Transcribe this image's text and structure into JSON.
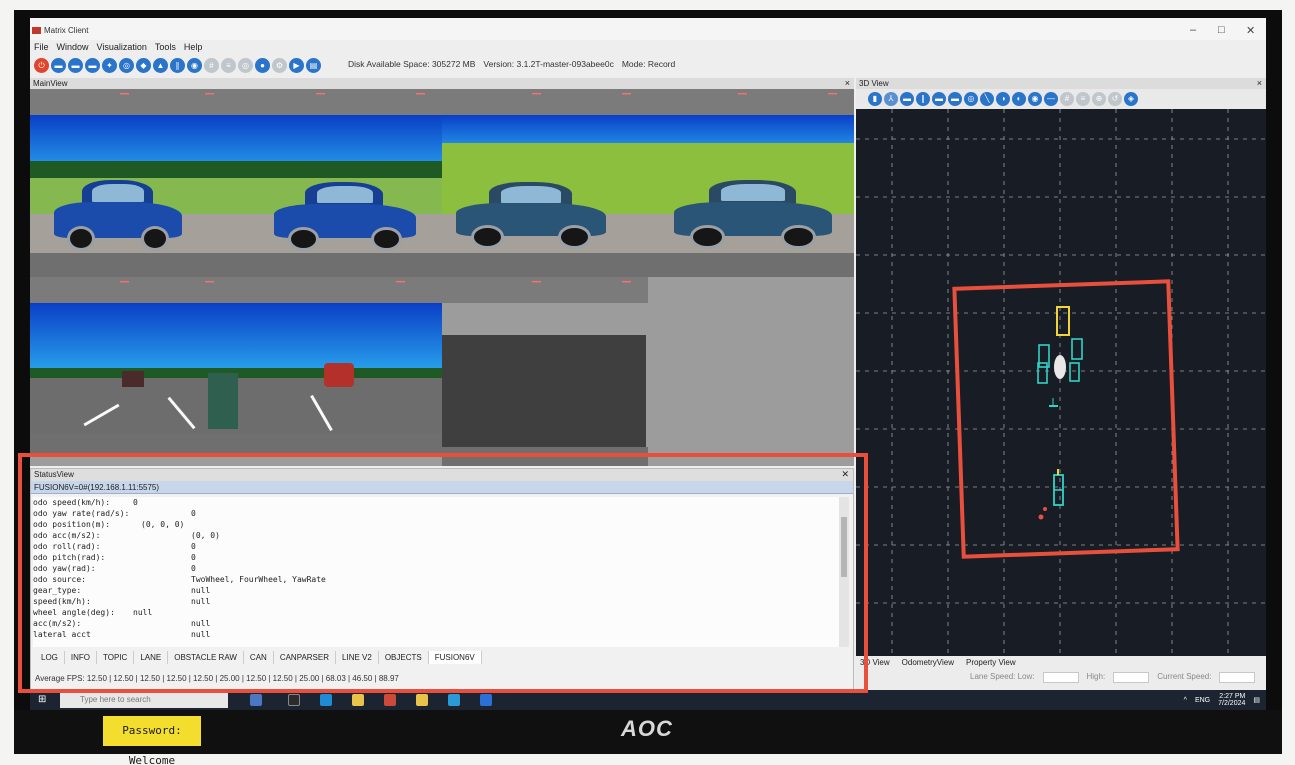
{
  "window": {
    "title": "Matrix Client",
    "controls": [
      "–",
      "□",
      "✕"
    ]
  },
  "menu": [
    "File",
    "Window",
    "Visualization",
    "Tools",
    "Help"
  ],
  "toolbar": {
    "disk": "Disk Available Space: 305272 MB",
    "version": "Version: 3.1.2T-master-093abee0c",
    "mode": "Mode: Record"
  },
  "mainview": {
    "title": "MainView",
    "close": "×"
  },
  "statusview": {
    "title": "StatusView",
    "source": "FUSION6V=0#(192.168.1.11:5575)",
    "lines": [
      {
        "k": "odo speed(km/h):",
        "v": "0",
        "vx": 100
      },
      {
        "k": "odo yaw rate(rad/s):",
        "v": "0",
        "vx": 158
      },
      {
        "k": "odo position(m):",
        "v": "(0, 0, 0)",
        "vx": 108
      },
      {
        "k": "odo acc(m/s2):",
        "v": "(0, 0)",
        "vx": 158
      },
      {
        "k": "odo roll(rad):",
        "v": "0",
        "vx": 158
      },
      {
        "k": "odo pitch(rad):",
        "v": "0",
        "vx": 158
      },
      {
        "k": "odo yaw(rad):",
        "v": "0",
        "vx": 158
      },
      {
        "k": "odo source:",
        "v": "TwoWheel, FourWheel, YawRate",
        "vx": 158
      },
      {
        "k": "gear_type:",
        "v": "null",
        "vx": 158
      },
      {
        "k": "speed(km/h):",
        "v": "null",
        "vx": 158
      },
      {
        "k": "wheel angle(deg):",
        "v": "null",
        "vx": 100
      },
      {
        "k": "acc(m/s2):",
        "v": "null",
        "vx": 158
      },
      {
        "k": "lateral acct",
        "v": "null",
        "vx": 158
      }
    ],
    "tabs": [
      "LOG",
      "INFO",
      "TOPIC",
      "LANE",
      "OBSTACLE RAW",
      "CAN",
      "CANPARSER",
      "LINE V2",
      "OBJECTS",
      "FUSION6V"
    ],
    "active_tab": "FUSION6V",
    "fps": "Average FPS:  12.50 | 12.50 | 12.50 | 12.50 | 12.50 | 25.00 | 12.50 | 12.50 | 25.00 | 68.03 | 46.50 | 88.97"
  },
  "view3d": {
    "title": "3D View",
    "close": "×",
    "tabs": [
      "3D View",
      "OdometryView",
      "Property View"
    ],
    "lane_speed_low": "Lane Speed: Low:",
    "high": "High:",
    "current_speed": "Current Speed:"
  },
  "taskbar": {
    "search": "Type here to search",
    "tray_lang": "ENG",
    "time": "2:27 PM",
    "date": "7/2/2024"
  },
  "monitor": {
    "brand": "AOC",
    "sticker": "Password: Welcome"
  },
  "colors": {
    "highlight": "#e8503d",
    "toolbar_icon": "#2a74c9",
    "object_box": "#2fd3c6",
    "ego_box": "#f0d43a"
  }
}
